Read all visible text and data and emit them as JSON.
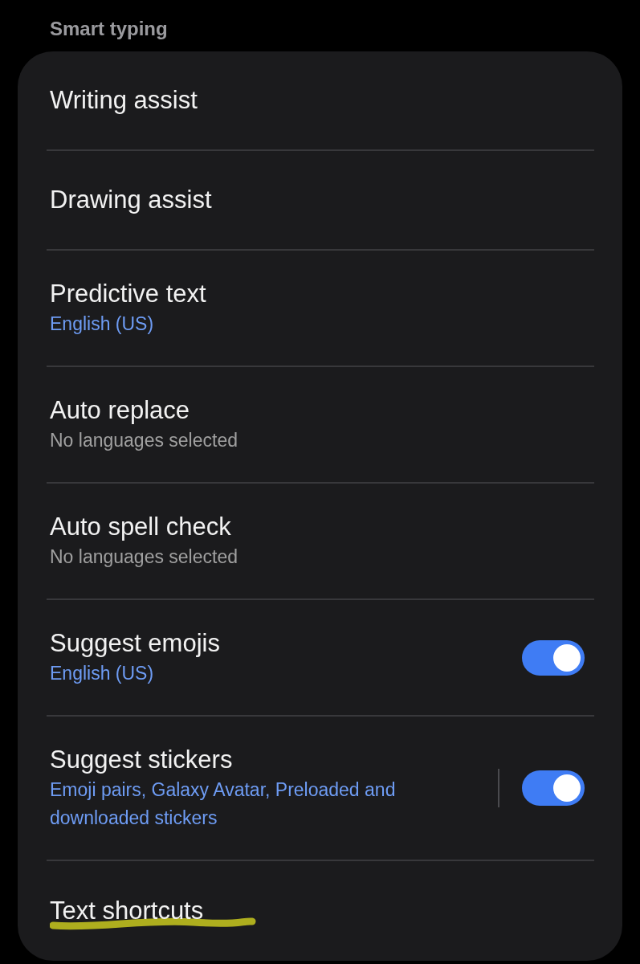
{
  "section_title": "Smart typing",
  "items": [
    {
      "title": "Writing assist"
    },
    {
      "title": "Drawing assist"
    },
    {
      "title": "Predictive text",
      "subtitle": {
        "text": "English (US)",
        "kind": "accent"
      }
    },
    {
      "title": "Auto replace",
      "subtitle": {
        "text": "No languages selected",
        "kind": "muted"
      }
    },
    {
      "title": "Auto spell check",
      "subtitle": {
        "text": "No languages selected",
        "kind": "muted"
      }
    },
    {
      "title": "Suggest emojis",
      "subtitle": {
        "text": "English (US)",
        "kind": "accent"
      },
      "toggle": {
        "on": true
      }
    },
    {
      "title": "Suggest stickers",
      "subtitle": {
        "text": "Emoji pairs, Galaxy Avatar, Preloaded and downloaded stickers",
        "kind": "accent"
      },
      "toggle": {
        "on": true
      },
      "split": true
    },
    {
      "title": "Text shortcuts",
      "highlighted": true
    }
  ]
}
